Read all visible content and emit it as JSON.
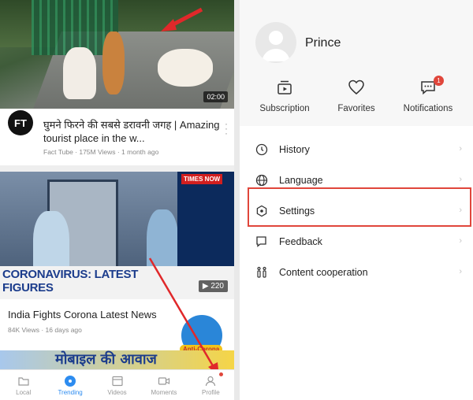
{
  "left_panel": {
    "video1": {
      "duration": "02:00",
      "channel_avatar_text": "FT",
      "title": "घुमने फिरने की सबसे डरावनी जगह | Amazing tourist place in the w...",
      "meta": "Fact Tube · 175M Views · 1 month ago"
    },
    "video2": {
      "channel_badge": "TIMES NOW",
      "banner_text": "CORONAVIRUS: LATEST FIGURES",
      "video_count": "220",
      "title": "India Fights Corona Latest News",
      "meta": "84K Views · 16 days ago",
      "anti_label": "Anti-Corona"
    },
    "ad_text": "मोबाइल की आवाज",
    "tabbar": {
      "local": "Local",
      "trending": "Trending",
      "videos": "Videos",
      "moments": "Moments",
      "profile": "Profile"
    },
    "accent_color": "#2d8cf0"
  },
  "right_panel": {
    "username": "Prince",
    "quick_actions": {
      "subscription": "Subscription",
      "favorites": "Favorites",
      "notifications": "Notifications",
      "notifications_badge": "1"
    },
    "menu": {
      "history": "History",
      "language": "Language",
      "settings": "Settings",
      "feedback": "Feedback",
      "content_cooperation": "Content cooperation"
    },
    "highlight_color": "#e0463b"
  }
}
